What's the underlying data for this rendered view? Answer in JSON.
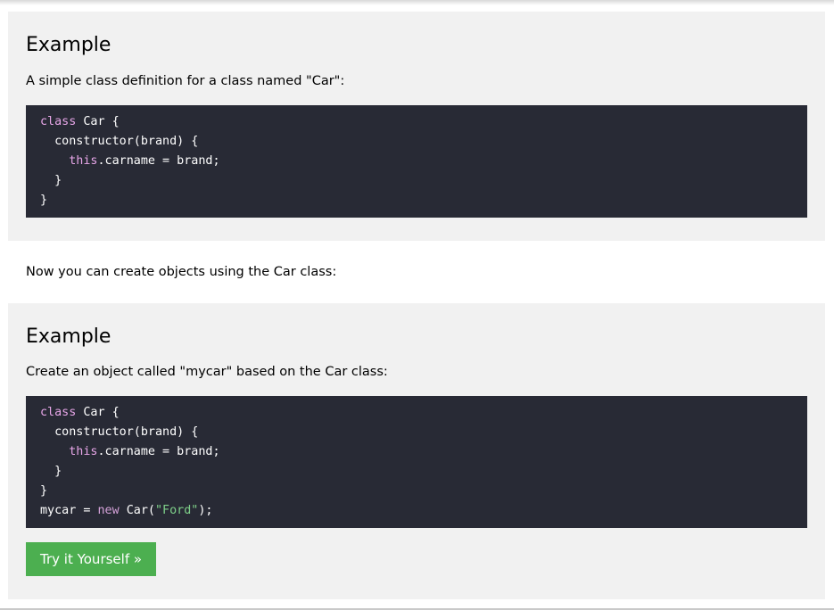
{
  "examples": [
    {
      "heading": "Example",
      "description": "A simple class definition for a class named \"Car\":",
      "code": {
        "l1_kw": "class",
        "l1_rest": " Car {",
        "l2": "  constructor(brand) {",
        "l3_indent": "    ",
        "l3_kw": "this",
        "l3_rest": ".carname = brand;",
        "l4": "  }",
        "l5": "}"
      }
    },
    {
      "heading": "Example",
      "description": "Create an object called \"mycar\" based on the Car class:",
      "code": {
        "l1_kw": "class",
        "l1_rest": " Car {",
        "l2": "  constructor(brand) {",
        "l3_indent": "    ",
        "l3_kw": "this",
        "l3_rest": ".carname = brand;",
        "l4": "  }",
        "l5": "}",
        "l6_a": "mycar = ",
        "l6_kw": "new",
        "l6_b": " Car(",
        "l6_str": "\"Ford\"",
        "l6_c": ");"
      },
      "button_label": "Try it Yourself »"
    }
  ],
  "between_text": "Now you can create objects using the Car class:",
  "colors": {
    "panel_bg": "#f1f1f1",
    "code_bg": "#282a35",
    "keyword": "#e7a6e8",
    "string": "#7fd18a",
    "button_bg": "#4caf50"
  }
}
